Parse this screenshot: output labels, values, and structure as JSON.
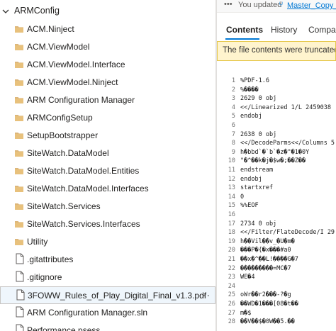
{
  "tree": {
    "root": {
      "label": "ARMConfig"
    },
    "items": [
      {
        "label": "ACM.Ninject",
        "type": "folder"
      },
      {
        "label": "ACM.ViewModel",
        "type": "folder"
      },
      {
        "label": "ACM.ViewModel.Interface",
        "type": "folder"
      },
      {
        "label": "ACM.ViewModel.Ninject",
        "type": "folder"
      },
      {
        "label": "ARM Configuration Manager",
        "type": "folder"
      },
      {
        "label": "ARMConfigSetup",
        "type": "folder"
      },
      {
        "label": "SetupBootstrapper",
        "type": "folder"
      },
      {
        "label": "SiteWatch.DataModel",
        "type": "folder"
      },
      {
        "label": "SiteWatch.DataModel.Entities",
        "type": "folder"
      },
      {
        "label": "SiteWatch.DataModel.Interfaces",
        "type": "folder"
      },
      {
        "label": "SiteWatch.Services",
        "type": "folder"
      },
      {
        "label": "SiteWatch.Services.Interfaces",
        "type": "folder"
      },
      {
        "label": "Utility",
        "type": "folder"
      },
      {
        "label": ".gitattributes",
        "type": "file"
      },
      {
        "label": ".gitignore",
        "type": "file"
      },
      {
        "label": "3FOWW_Rules_of_Play_Digital_Final_v1.3.pdf",
        "type": "file",
        "selected": true,
        "more": "···"
      },
      {
        "label": "ARM Configuration Manager.sln",
        "type": "file"
      },
      {
        "label": "Performance.psess",
        "type": "file"
      }
    ]
  },
  "commit": {
    "text": "You updated",
    "branch": "Master_Copy_LF"
  },
  "tabs": [
    {
      "label": "Contents",
      "active": true
    },
    {
      "label": "History",
      "active": false
    },
    {
      "label": "Compare",
      "active": false
    }
  ],
  "warning": "The file contents were truncated s",
  "code": [
    {
      "n": "1",
      "t": "%PDF-1.6"
    },
    {
      "n": "2",
      "t": "%����"
    },
    {
      "n": "3",
      "t": "2629 0 obj"
    },
    {
      "n": "4",
      "t": "<</Linearized 1/L 2459038"
    },
    {
      "n": "5",
      "t": "endobj"
    },
    {
      "n": "6",
      "t": ""
    },
    {
      "n": "7",
      "t": "2638 0 obj"
    },
    {
      "n": "8",
      "t": "<</DecodeParms<</Columns 5"
    },
    {
      "n": "9",
      "t": "h�bbd`�`b`�z�\"�1�0Y"
    },
    {
      "n": "10",
      "t": "\"�^��k�j�$w�;��Z��"
    },
    {
      "n": "11",
      "t": "endstream"
    },
    {
      "n": "12",
      "t": "endobj"
    },
    {
      "n": "13",
      "t": "startxref"
    },
    {
      "n": "14",
      "t": "0"
    },
    {
      "n": "15",
      "t": "%%EOF"
    },
    {
      "n": "16",
      "t": ""
    },
    {
      "n": "17",
      "t": "2734 0 obj"
    },
    {
      "n": "18",
      "t": "<</Filter/FlateDecode/I 29"
    },
    {
      "n": "19",
      "t": "h��Vil��v_�U�m�"
    },
    {
      "n": "20",
      "t": "���P�{�x���#a0"
    },
    {
      "n": "21",
      "t": "��x�^��L!����G�7"
    },
    {
      "n": "22",
      "t": "���������=MC�7"
    },
    {
      "n": "23",
      "t": "WE�4"
    },
    {
      "n": "24",
      "t": ""
    },
    {
      "n": "25",
      "t": "oWr��r2���-?�g"
    },
    {
      "n": "26",
      "t": "��WD�1���[08�t��"
    },
    {
      "n": "27",
      "t": "m�$"
    },
    {
      "n": "28",
      "t": "��V��$�0W��5.��"
    }
  ]
}
